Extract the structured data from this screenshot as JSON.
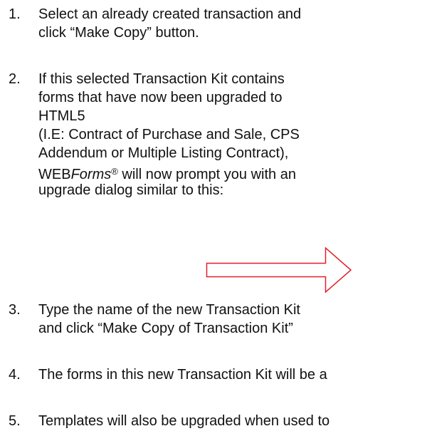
{
  "steps": [
    {
      "number": "1.",
      "lines": [
        "Select an already created transaction and",
        "click “Make Copy” button."
      ]
    },
    {
      "number": "2.",
      "lines": [
        "If this selected Transaction Kit contains",
        "forms that have now been upgraded to",
        "HTML5",
        "(I.E: Contract of Purchase and Sale, CPS",
        "Addendum or Multiple Listing Contract),"
      ],
      "brand_prefix": "WEB",
      "brand_italic": "Forms",
      "brand_mark": "®",
      "brand_suffix": " will now prompt you with an",
      "last_line": "upgrade dialog similar to this:"
    },
    {
      "number": "3.",
      "lines": [
        "Type the name of the new Transaction Kit",
        "and click “Make Copy of Transaction Kit”"
      ]
    },
    {
      "number": "4.",
      "lines": [
        "The forms in this new Transaction Kit will be a"
      ]
    },
    {
      "number": "5.",
      "lines": [
        "Templates will also be upgraded when used to"
      ]
    }
  ],
  "colors": {
    "text": "#111111",
    "arrow_stroke": "#e0202a"
  },
  "icons": {
    "arrow": "right-arrow-outline-icon"
  }
}
